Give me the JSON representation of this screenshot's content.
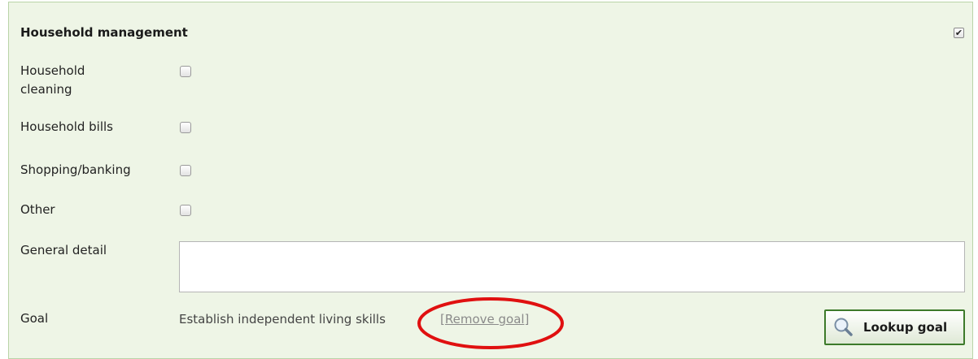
{
  "section": {
    "title": "Household management",
    "enabled_checked": true
  },
  "rows": [
    {
      "label": "Household cleaning",
      "checked": false
    },
    {
      "label": "Household bills",
      "checked": false
    },
    {
      "label": "Shopping/banking",
      "checked": false
    },
    {
      "label": "Other",
      "checked": false
    }
  ],
  "general_detail": {
    "label": "General detail",
    "value": ""
  },
  "goal": {
    "label": "Goal",
    "value": "Establish independent living skills",
    "remove_link": "[Remove goal]",
    "lookup_button": "Lookup goal"
  },
  "annotation": {
    "highlight_color": "#e01010"
  },
  "colors": {
    "panel_bg": "#eef5e6",
    "button_border": "#3d7a2a"
  }
}
